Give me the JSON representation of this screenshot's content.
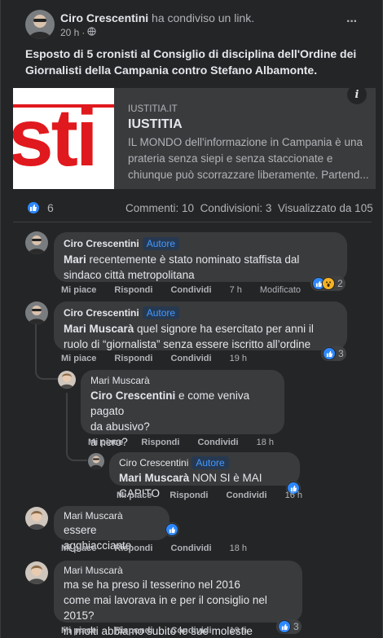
{
  "post": {
    "author": "Ciro Crescentini",
    "action": "ha condiviso un link.",
    "time": "20 h",
    "dot": "·",
    "more": "···",
    "text": "Esposto di 5 cronisti al Consiglio di disciplina dell'Ordine dei Giornalisti della Campania contro Stefano Albamonte."
  },
  "link": {
    "thumb_text": "sti",
    "domain": "IUSTITIA.IT",
    "title": "IUSTITIA",
    "description": "IL MONDO dell'informazione in Campania è una prateria senza siepi e senza staccionate e chiunque può scorrazzare liberamente. Partend...",
    "info": "i"
  },
  "stats": {
    "likes": "6",
    "comments": "Commenti: 10",
    "shares": "Condivisioni: 3",
    "views": "Visualizzato da 105"
  },
  "labels": {
    "author_badge": "Autore",
    "like": "Mi piace",
    "reply": "Rispondi",
    "share": "Condividi",
    "edited": "Modificato"
  },
  "comments": [
    {
      "name": "Ciro Crescentini",
      "mention": "Mari",
      "text": " recentemente è stato nominato staffista dal sindaco città metropolitana",
      "time": "7 h",
      "reactions": "2"
    },
    {
      "name": "Ciro Crescentini",
      "mention": "Mari Muscarà",
      "text": " quel signore ha esercitato per anni il ruolo di “giornalista” senza essere iscritto all’ordine",
      "time": "19 h",
      "reactions": "3"
    },
    {
      "name": "Mari Muscarà",
      "mention": "Ciro Crescentini",
      "text_line1": " e come veniva pagato",
      "text_line2": "da abusivo?",
      "text_line3": "a nero?",
      "time": "18 h"
    },
    {
      "name": "Ciro Crescentini",
      "mention": "Mari Muscarà",
      "text": " NON SI è MAI CAPITO",
      "time": "16 h"
    },
    {
      "name": "Mari Muscarà",
      "text": "essere agghiacciante",
      "time": "18 h"
    },
    {
      "name": "Mari Muscarà",
      "text_line1": "ma se ha preso il tesserino nel 2016",
      "text_line2": "come mai lavorava in e per il consiglio nel 2015?",
      "text_line3": "in molti abbiamo subito le sue molestie",
      "time": "19 h",
      "reactions": "3"
    }
  ],
  "colors": {
    "background": "#242526",
    "bubble": "#3a3b3c",
    "accent": "#2d88ff",
    "thumb_red": "#e0191e"
  }
}
